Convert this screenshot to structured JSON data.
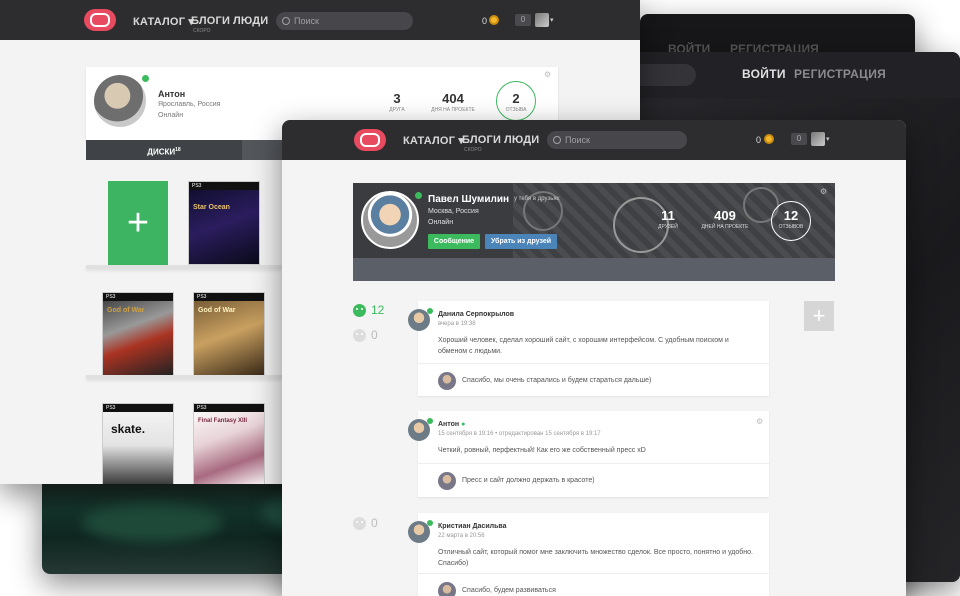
{
  "colors": {
    "accent": "#e84a5f",
    "green": "#3cba5e",
    "dark_nav": "#2d2d2f",
    "blue_button": "#4a84b8",
    "gold": "#f2b62a"
  },
  "dark_window": {
    "login": "ВОЙТИ",
    "register": "РЕГИСТРАЦИЯ"
  },
  "nav": {
    "catalog": "КАТАЛОГ",
    "blogs": "БЛОГИ",
    "blogs_sub": "СКОРО",
    "people": "ЛЮДИ",
    "search_placeholder": "Поиск",
    "coins": "0",
    "notifications": "0"
  },
  "back_profile": {
    "name": "Антон",
    "city": "Ярославль, Россия",
    "status": "Онлайн",
    "stats": [
      {
        "value": "3",
        "label": "друга"
      },
      {
        "value": "404",
        "label": "дня на проекте"
      },
      {
        "value": "2",
        "label": "отзыва"
      }
    ],
    "tab_label": "ДИСКИ",
    "tab_count": "18"
  },
  "discs": [
    {
      "platform": "PS3",
      "title": "Star Ocean"
    },
    {
      "platform": "PS3",
      "title": "God of War"
    },
    {
      "platform": "PS3",
      "title": "God of War"
    },
    {
      "platform": "PS3",
      "title": "skate."
    },
    {
      "platform": "PS3",
      "title": "Final Fantasy XIII"
    }
  ],
  "front_profile": {
    "name": "Павел Шумилин",
    "relation": "у тебя в друзьях",
    "city": "Москва, Россия",
    "status": "Онлайн",
    "message_btn": "Сообщение",
    "remove_btn": "Убрать из друзей",
    "stats": [
      {
        "value": "11",
        "label": "друзей"
      },
      {
        "value": "409",
        "label": "дней на проекте"
      },
      {
        "value": "12",
        "label": "отзывов"
      }
    ]
  },
  "votes": [
    {
      "count": "12"
    },
    {
      "count": "0"
    },
    {
      "count": "0"
    }
  ],
  "reviews": [
    {
      "author": "Данила Серпокрылов",
      "date": "вчера в 19:38",
      "text": "Хороший человек, сделал хороший сайт, с хорошим интерфейсом. С удобным поиском и обменом с людьми.",
      "reply": "Спасибо, мы очень старались и будем стараться дальше)"
    },
    {
      "author": "Антон",
      "date": "15 сентября в 19:16",
      "edited": "отредактирован 15 сентября в 19:17",
      "text": "Четкий, ровный, перфектный! Как его же собственный пресс xD",
      "reply": "Пресс и сайт должно держать в красоте)"
    },
    {
      "author": "Кристиан Дасильва",
      "date": "22 марта в 20:56",
      "text": "Отличный сайт, который помог мне заключить множество сделок. Все просто, понятно и удобно. Спасибо)",
      "reply": "Спасибо, будем развиваться"
    }
  ]
}
